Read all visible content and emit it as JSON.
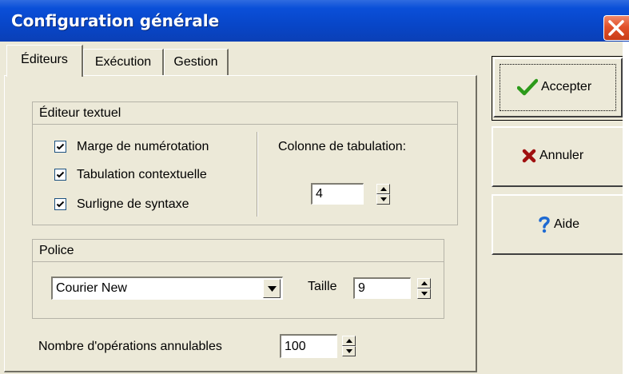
{
  "window": {
    "title": "Configuration générale"
  },
  "tabs": [
    {
      "label": "Éditeurs",
      "active": true
    },
    {
      "label": "Exécution",
      "active": false
    },
    {
      "label": "Gestion",
      "active": false
    }
  ],
  "editor_group": {
    "title": "Éditeur textuel",
    "checkboxes": [
      {
        "label": "Marge de numérotation",
        "checked": true
      },
      {
        "label": "Tabulation contextuelle",
        "checked": true
      },
      {
        "label": "Surligne de syntaxe",
        "checked": true
      }
    ],
    "tab_column_label": "Colonne de tabulation:",
    "tab_column_value": "4"
  },
  "font_group": {
    "title": "Police",
    "font_value": "Courier New",
    "size_label": "Taille",
    "size_value": "9"
  },
  "undo": {
    "label": "Nombre d'opérations annulables",
    "value": "100"
  },
  "buttons": {
    "accept": "Accepter",
    "cancel": "Annuler",
    "help": "Aide"
  },
  "icons": {
    "accept": "checkmark-icon",
    "cancel": "x-icon",
    "help": "question-mark-icon",
    "close": "close-icon"
  },
  "colors": {
    "titlebar": "#0a4fd8",
    "close_button": "#e2522b",
    "accept_check": "#2c9a1a",
    "cancel_x": "#a01010",
    "help_question": "#1e6ad2"
  }
}
